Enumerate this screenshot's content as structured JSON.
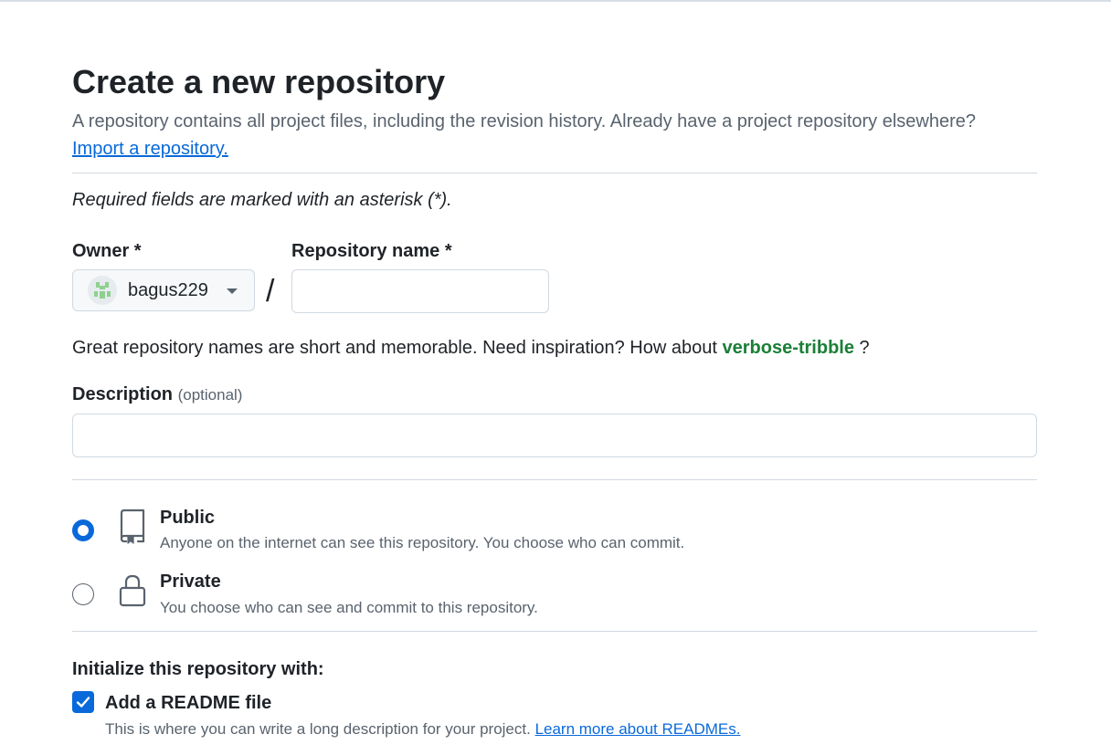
{
  "page": {
    "title": "Create a new repository",
    "subtitle": "A repository contains all project files, including the revision history. Already have a project repository elsewhere?",
    "import_link": "Import a repository.",
    "required_note": "Required fields are marked with an asterisk (*)."
  },
  "owner": {
    "label": "Owner *",
    "value": "bagus229"
  },
  "repository": {
    "label": "Repository name *",
    "value": "",
    "separator": "/"
  },
  "hint": {
    "text": "Great repository names are short and memorable. Need inspiration? How about",
    "suggestion": "verbose-tribble",
    "suffix": "?"
  },
  "description": {
    "label": "Description",
    "optional": "(optional)",
    "value": ""
  },
  "visibility": {
    "selected": "public",
    "options": [
      {
        "title": "Public",
        "desc": "Anyone on the internet can see this repository. You choose who can commit.",
        "icon": "repo-icon"
      },
      {
        "title": "Private",
        "desc": "You choose who can see and commit to this repository.",
        "icon": "lock-icon"
      }
    ]
  },
  "initialize": {
    "label": "Initialize this repository with:",
    "readme_title": "Add a README file",
    "readme_checked": true,
    "readme_desc": "This is where you can write a long description for your project.",
    "readme_link": "Learn more about READMEs."
  },
  "colors": {
    "accent": "#0969da",
    "suggestion": "#1a7f37",
    "muted": "#59636e"
  }
}
